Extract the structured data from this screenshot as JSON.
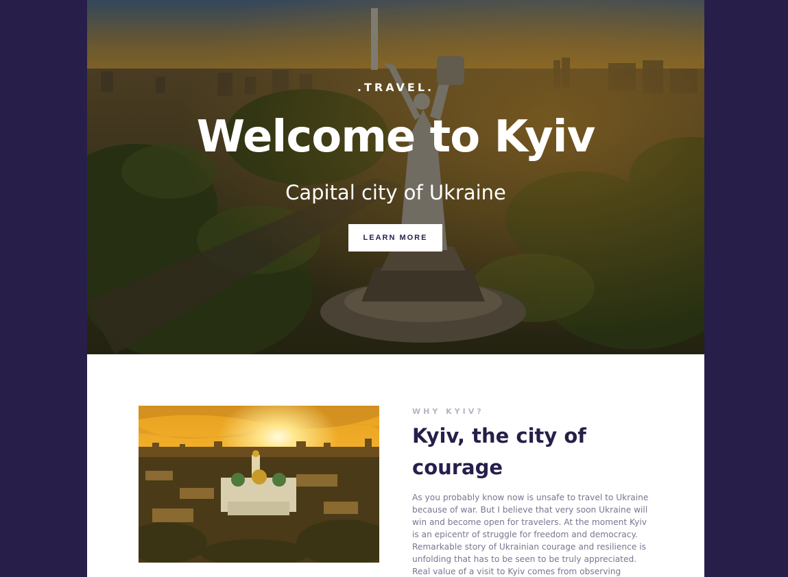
{
  "hero": {
    "eyebrow": ".TRAVEL.",
    "title": "Welcome to Kyiv",
    "subtitle": "Capital city of Ukraine",
    "cta_label": "LEARN MORE"
  },
  "about": {
    "eyebrow": "WHY KYIV?",
    "title": "Kyiv, the city of courage",
    "body": "As you probably know now is unsafe to travel to Ukraine because of war. But I believe that very soon Ukraine will win and become open for travelers. At the moment Kyiv is an epicentr of struggle for freedom and democracy. Remarkable story of Ukrainian courage and resilience is unfolding that has to be seen to be truly appreciated. Real value of a visit to Kyiv comes from observing European"
  },
  "colors": {
    "page_background": "#271e4a",
    "accent_dark": "#271e4a",
    "muted_text": "#7a7590",
    "eyebrow_muted": "#b8b4c4"
  }
}
